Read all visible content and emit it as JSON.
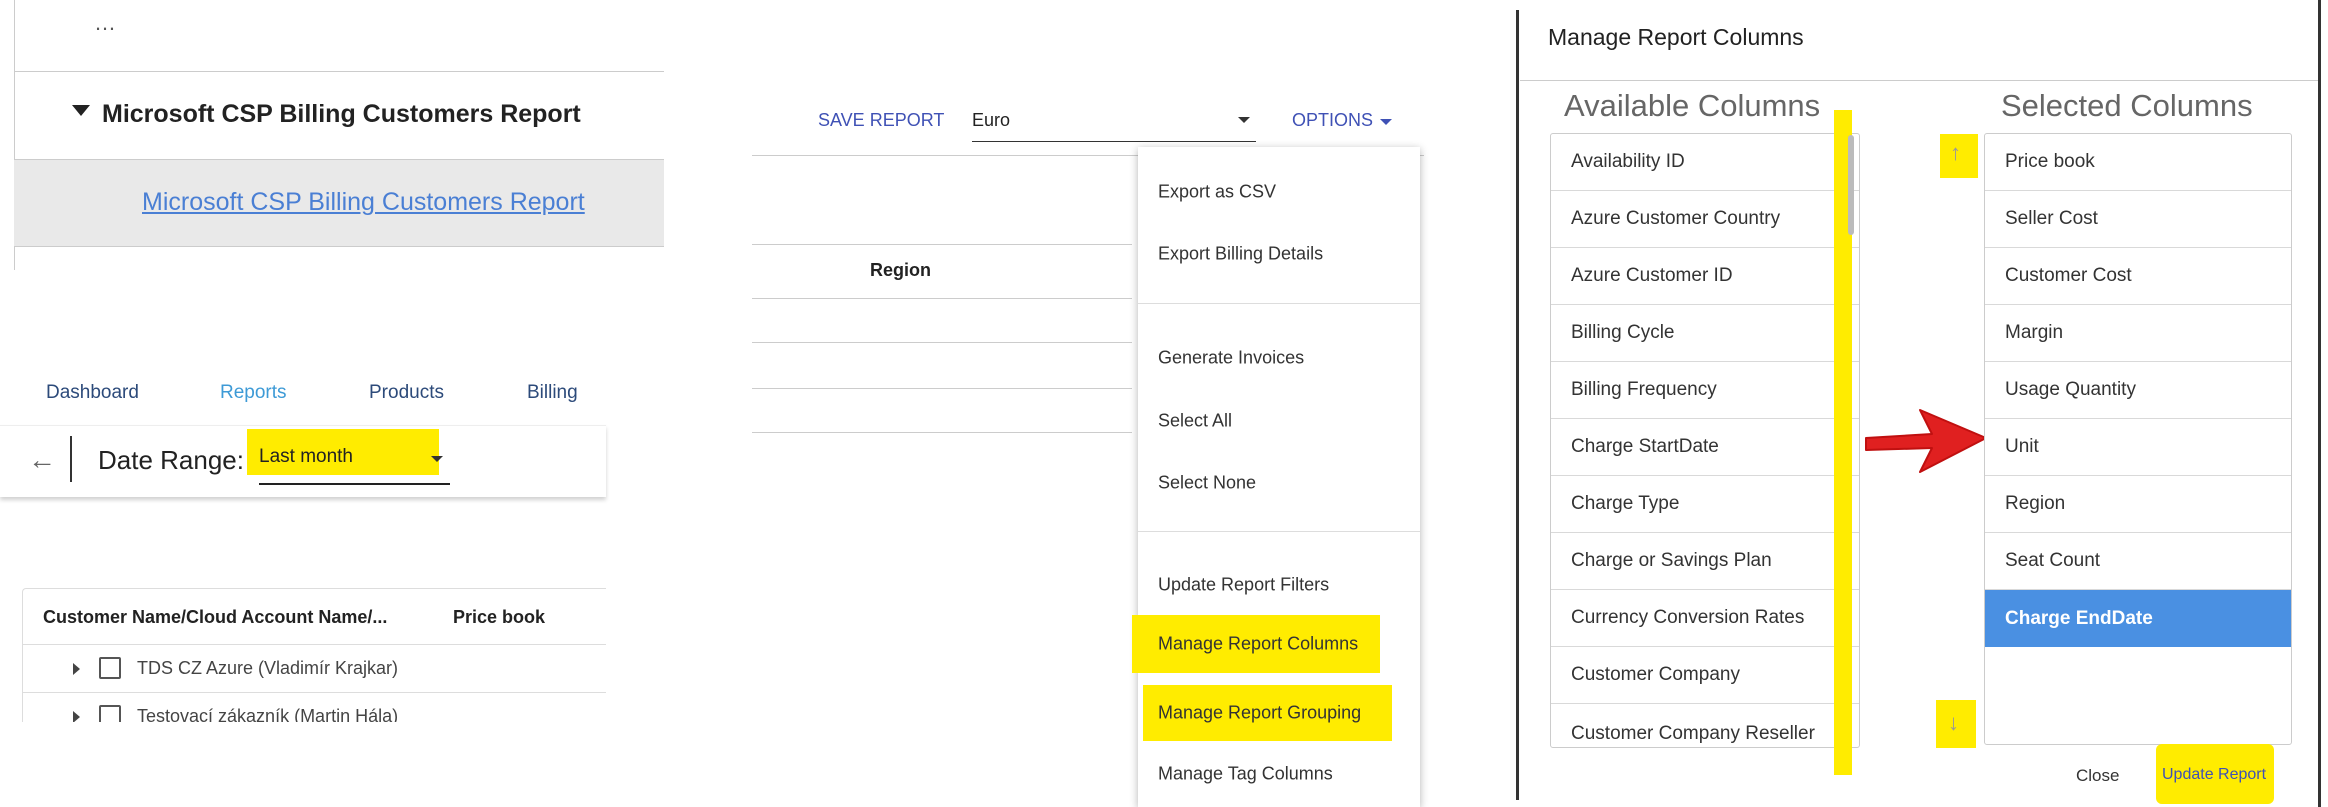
{
  "reports_panel": {
    "truncated_header": "…",
    "group_title": "Microsoft CSP Billing Customers Report",
    "report_link": "Microsoft CSP Billing Customers Report"
  },
  "nav": {
    "tabs": [
      "Dashboard",
      "Reports",
      "Products",
      "Billing"
    ],
    "active_tab": "Reports",
    "date_range_label": "Date Range:",
    "date_range_value": "Last month"
  },
  "customer_table": {
    "headers": [
      "Customer Name/Cloud Account Name/...",
      "Price book"
    ],
    "rows": [
      "TDS CZ Azure (Vladimír Krajkar)",
      "Testovací zákazník (Martin Hála)"
    ]
  },
  "toolbar": {
    "save_report": "SAVE REPORT",
    "currency": "Euro",
    "options": "OPTIONS",
    "region_header": "Region"
  },
  "options_menu": [
    "Export as CSV",
    "Export Billing Details",
    "Generate Invoices",
    "Select All",
    "Select None",
    "Update Report Filters",
    "Manage Report Columns",
    "Manage Report Grouping",
    "Manage Tag Columns"
  ],
  "dialog": {
    "title": "Manage Report Columns",
    "available_title": "Available Columns",
    "selected_title": "Selected Columns",
    "available": [
      "Availability ID",
      "Azure Customer Country",
      "Azure Customer ID",
      "Billing Cycle",
      "Billing Frequency",
      "Charge StartDate",
      "Charge Type",
      "Charge or Savings Plan",
      "Currency Conversion Rates",
      "Customer Company",
      "Customer Company Reseller"
    ],
    "selected": [
      "Price book",
      "Seller Cost",
      "Customer Cost",
      "Margin",
      "Usage Quantity",
      "Unit",
      "Region",
      "Seat Count",
      "Charge EndDate"
    ],
    "selected_active": "Charge EndDate",
    "close": "Close",
    "update": "Update Report"
  },
  "colors": {
    "highlight": "#ffec00",
    "accent_blue": "#3f51b5",
    "link": "#1a73e8",
    "selected_row": "#4a90e2",
    "arrow_red": "#e02020"
  }
}
